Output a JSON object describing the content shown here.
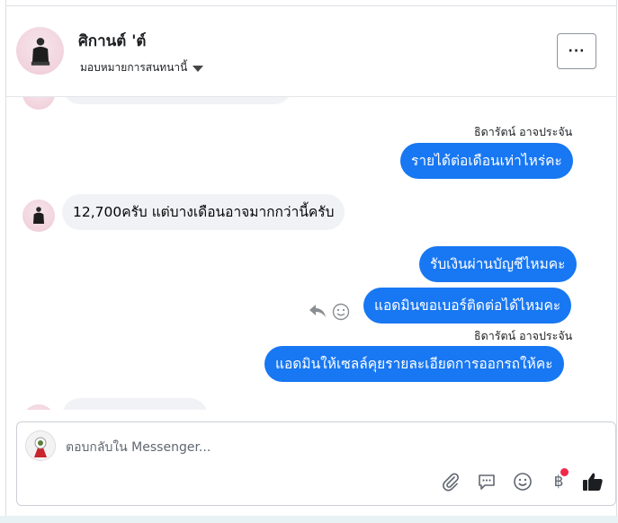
{
  "header": {
    "name": "ศิกานต์ 'ต์",
    "subtitle": "มอบหมายการสนทนานี้",
    "more_label": "···"
  },
  "thread": {
    "messages": [
      {
        "direction": "out",
        "sender": "ธิดารัตน์ อาจประจัน",
        "text": "รายได้ต่อเดือนเท่าไหร่คะ"
      },
      {
        "direction": "in",
        "text": "12,700ครับ แต่บางเดือนอาจมากกว่านี้ครับ"
      },
      {
        "direction": "out",
        "text": "รับเงินผ่านบัญชีไหมคะ"
      },
      {
        "direction": "out",
        "text": "แอดมินขอเบอร์ติดต่อได้ไหมคะ"
      },
      {
        "direction": "out",
        "sender": "ธิดารัตน์ อาจประจัน",
        "text": "แอดมินให้เซลล์คุยรายละเอียดการออกรถให้คะ"
      }
    ]
  },
  "composer": {
    "placeholder": "ตอบกลับใน Messenger...",
    "value": "",
    "currency_symbol": "฿"
  },
  "icons": {
    "reply": "reply-icon",
    "react": "smiley-icon",
    "attach": "paperclip-icon",
    "saved_replies": "chat-bubble-icon",
    "emoji": "smiley-icon",
    "payment": "baht-icon",
    "like": "thumbs-up-icon"
  },
  "colors": {
    "outgoing_bubble": "#1877f2",
    "incoming_bubble": "#f0f2f5",
    "notification_dot": "#f02849"
  }
}
